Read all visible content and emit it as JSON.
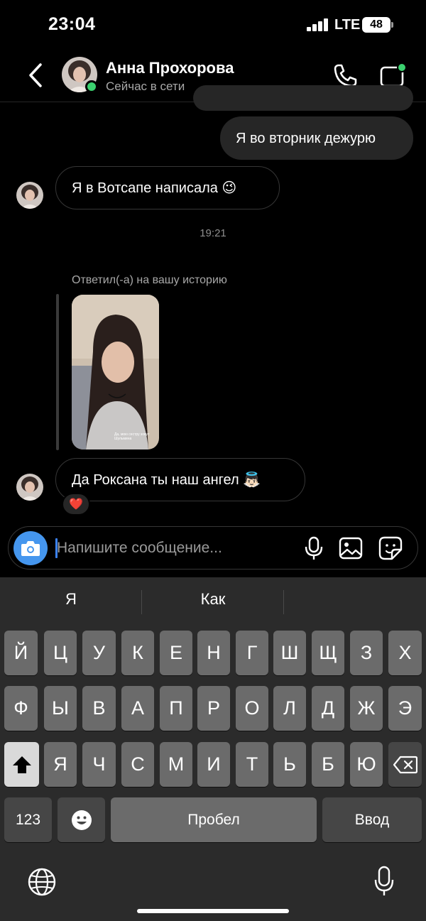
{
  "status_bar": {
    "time": "23:04",
    "network": "LTE",
    "battery": "48"
  },
  "header": {
    "contact_name": "Анна Прохорова",
    "contact_status": "Сейчас в сети",
    "icons": [
      "chevron-left-icon",
      "phone-icon",
      "video-camera-icon"
    ]
  },
  "messages": [
    {
      "direction": "out",
      "text": "Я во вторник дежурю"
    },
    {
      "direction": "in",
      "text": "Я в Вотсапе написала 😉"
    },
    {
      "type": "timestamp",
      "text": "19:21"
    },
    {
      "direction": "in",
      "type": "story_reply",
      "label": "Ответил(-а) на вашу историю",
      "story_caption": "Да, мою сестру зовут Шульмина"
    },
    {
      "direction": "in",
      "text": "Да Роксана ты наш ангел 👼🏻",
      "reaction": "❤️"
    }
  ],
  "composer": {
    "placeholder": "Напишите сообщение..."
  },
  "keyboard": {
    "suggestions": [
      "Я",
      "Как",
      ""
    ],
    "row1": [
      "Й",
      "Ц",
      "У",
      "К",
      "Е",
      "Н",
      "Г",
      "Ш",
      "Щ",
      "З",
      "Х"
    ],
    "row2": [
      "Ф",
      "Ы",
      "В",
      "А",
      "П",
      "Р",
      "О",
      "Л",
      "Д",
      "Ж",
      "Э"
    ],
    "row3": [
      "Я",
      "Ч",
      "С",
      "М",
      "И",
      "Т",
      "Ь",
      "Б",
      "Ю"
    ],
    "numbers_label": "123",
    "space_label": "Пробел",
    "return_label": "Ввод"
  },
  "colors": {
    "background": "#000000",
    "bubble_outgoing": "#262626",
    "online_indicator": "#3bd16f",
    "camera_button": "#4596ee",
    "keyboard_bg": "#2b2b2b"
  }
}
